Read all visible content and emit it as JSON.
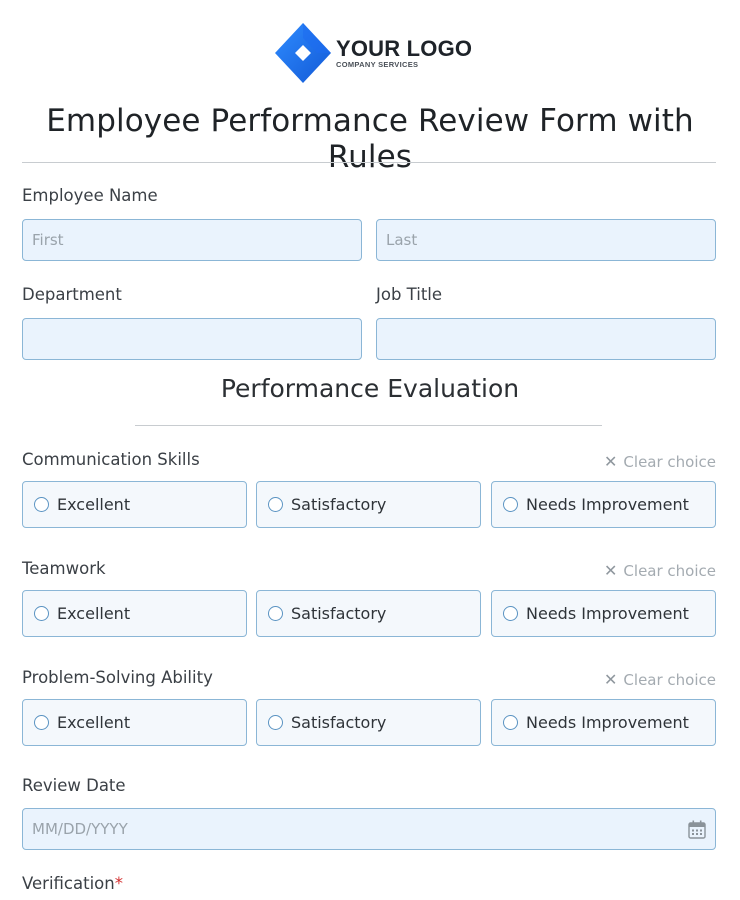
{
  "logo": {
    "title": "YOUR LOGO",
    "subtitle": "COMPANY SERVICES",
    "mark_color": "#1a73e8"
  },
  "form": {
    "title": "Employee Performance Review Form with Rules"
  },
  "employee_name": {
    "label": "Employee Name",
    "first_placeholder": "First",
    "last_placeholder": "Last"
  },
  "department": {
    "label": "Department"
  },
  "job_title": {
    "label": "Job Title"
  },
  "section": {
    "title": "Performance Evaluation"
  },
  "clear_choice": "Clear choice",
  "questions": [
    {
      "label": "Communication Skills",
      "options": [
        "Excellent",
        "Satisfactory",
        "Needs Improvement"
      ]
    },
    {
      "label": "Teamwork",
      "options": [
        "Excellent",
        "Satisfactory",
        "Needs Improvement"
      ]
    },
    {
      "label": "Problem-Solving Ability",
      "options": [
        "Excellent",
        "Satisfactory",
        "Needs Improvement"
      ]
    }
  ],
  "review_date": {
    "label": "Review Date",
    "placeholder": "MM/DD/YYYY",
    "icon": "calendar-icon"
  },
  "verification": {
    "label": "Verification",
    "required_mark": "*"
  },
  "colors": {
    "field_bg": "#eaf3fd",
    "field_border": "#8bb6d6",
    "required": "#d32f2f",
    "accent": "#1a73e8"
  }
}
